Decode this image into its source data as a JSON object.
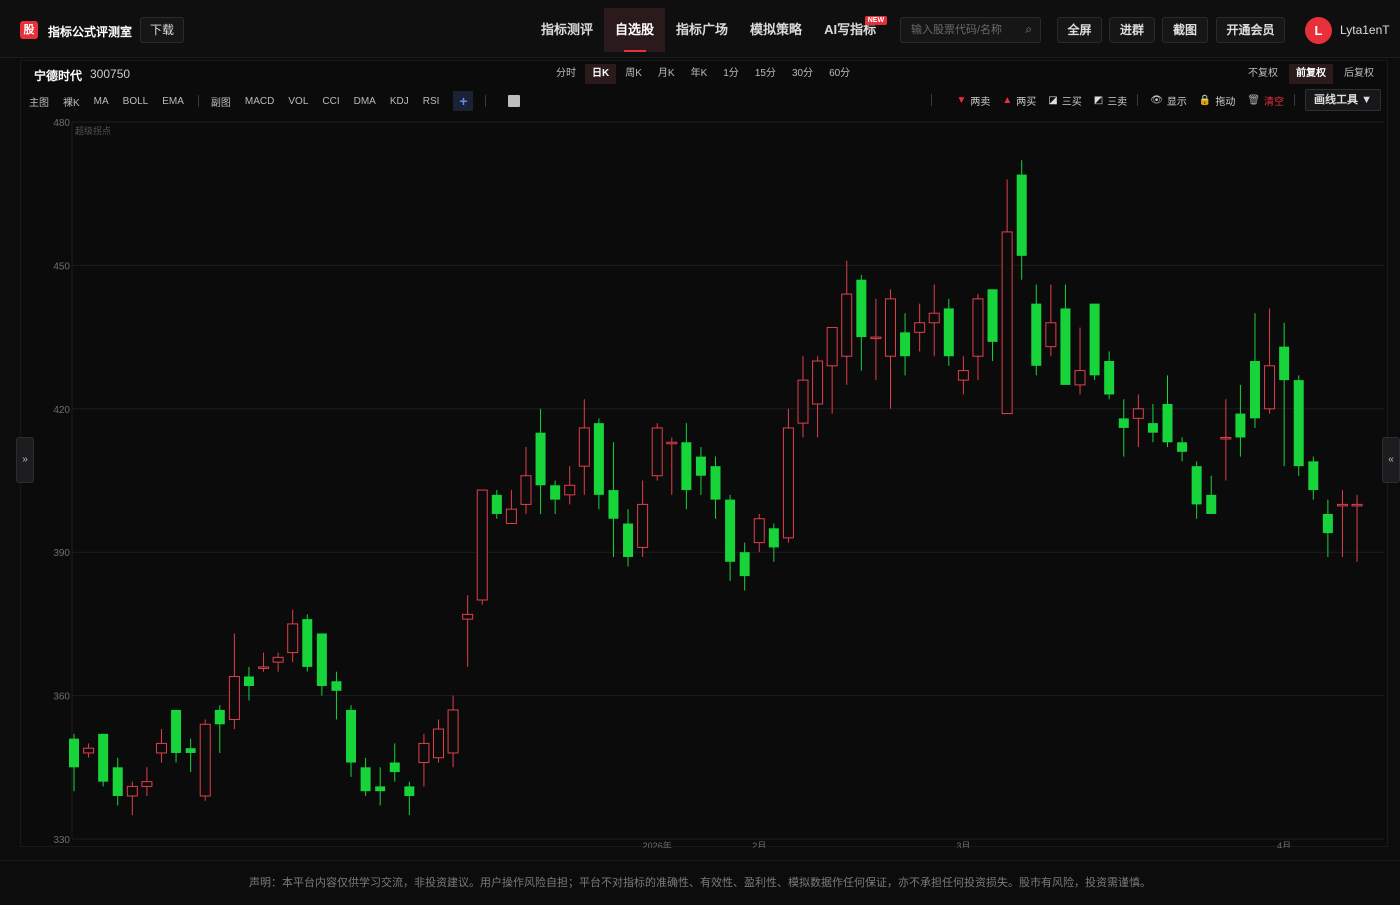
{
  "header": {
    "logo_text": "股",
    "brand": "指标公式评测室",
    "download": "下载",
    "nav": [
      "指标测评",
      "自选股",
      "指标广场",
      "模拟策略",
      "AI写指标"
    ],
    "nav_active": 1,
    "ai_badge": "NEW",
    "search_placeholder": "输入股票代码/名称",
    "buttons": [
      "全屏",
      "进群",
      "截图",
      "开通会员"
    ],
    "avatar_letter": "L",
    "username": "Lyta1enT"
  },
  "stock": {
    "name": "宁德时代",
    "code": "300750"
  },
  "periods": [
    "分时",
    "日K",
    "周K",
    "月K",
    "年K",
    "1分",
    "15分",
    "30分",
    "60分"
  ],
  "period_active": 1,
  "rights": [
    "不复权",
    "前复权",
    "后复权"
  ],
  "rights_active": 1,
  "main_indicators": [
    "主图",
    "裸K",
    "MA",
    "BOLL",
    "EMA"
  ],
  "sub_indicators": [
    "副图",
    "MACD",
    "VOL",
    "CCI",
    "DMA",
    "KDJ",
    "RSI"
  ],
  "add_label": "+",
  "draw_tools": {
    "two_sell": "两卖",
    "two_buy": "两买",
    "three_buy": "三买",
    "three_sell": "三卖",
    "show": "显示",
    "drag": "拖动",
    "clear": "清空",
    "menu": "画线工具 ▼"
  },
  "chart_watermark": "超级拐点",
  "side_left": "»",
  "side_right": "«",
  "chart_data": {
    "type": "candlestick",
    "ylim": [
      330,
      480
    ],
    "yticks": [
      330,
      360,
      390,
      420,
      450,
      480
    ],
    "x_tick_labels": [
      "2026年",
      "2月",
      "3月",
      "4月"
    ],
    "x_tick_index": [
      40,
      47,
      61,
      83
    ],
    "colors": {
      "up": "#e0404a",
      "down": "#16d43a"
    },
    "candles": [
      [
        351,
        345,
        352,
        340
      ],
      [
        348,
        349,
        350,
        347
      ],
      [
        352,
        342,
        352,
        341
      ],
      [
        345,
        339,
        347,
        337
      ],
      [
        339,
        341,
        342,
        335
      ],
      [
        341,
        342,
        345,
        339
      ],
      [
        348,
        350,
        353,
        346
      ],
      [
        357,
        348,
        357,
        346
      ],
      [
        349,
        348,
        351,
        344
      ],
      [
        339,
        354,
        355,
        338
      ],
      [
        357,
        354,
        358,
        348
      ],
      [
        355,
        364,
        373,
        353
      ],
      [
        364,
        362,
        366,
        359
      ],
      [
        366,
        366,
        369,
        365
      ],
      [
        367,
        368,
        369,
        365
      ],
      [
        369,
        375,
        378,
        367
      ],
      [
        376,
        366,
        377,
        365
      ],
      [
        373,
        362,
        373,
        360
      ],
      [
        363,
        361,
        365,
        355
      ],
      [
        357,
        346,
        358,
        343
      ],
      [
        345,
        340,
        347,
        339
      ],
      [
        341,
        340,
        345,
        337
      ],
      [
        346,
        344,
        350,
        342
      ],
      [
        341,
        339,
        342,
        335
      ],
      [
        346,
        350,
        352,
        341
      ],
      [
        347,
        353,
        355,
        346
      ],
      [
        348,
        357,
        360,
        345
      ],
      [
        376,
        377,
        381,
        366
      ],
      [
        380,
        403,
        403,
        379
      ],
      [
        402,
        398,
        403,
        397
      ],
      [
        396,
        399,
        403,
        396
      ],
      [
        400,
        406,
        412,
        398
      ],
      [
        415,
        404,
        420,
        398
      ],
      [
        404,
        401,
        405,
        398
      ],
      [
        402,
        404,
        408,
        400
      ],
      [
        408,
        416,
        422,
        402
      ],
      [
        417,
        402,
        418,
        399
      ],
      [
        403,
        397,
        413,
        389
      ],
      [
        396,
        389,
        399,
        387
      ],
      [
        391,
        400,
        405,
        389
      ],
      [
        406,
        416,
        417,
        405
      ],
      [
        413,
        413,
        414,
        402
      ],
      [
        413,
        403,
        417,
        399
      ],
      [
        410,
        406,
        412,
        402
      ],
      [
        408,
        401,
        410,
        397
      ],
      [
        401,
        388,
        402,
        384
      ],
      [
        390,
        385,
        392,
        382
      ],
      [
        392,
        397,
        398,
        390
      ],
      [
        395,
        391,
        396,
        388
      ],
      [
        393,
        416,
        420,
        392
      ],
      [
        417,
        426,
        431,
        414
      ],
      [
        421,
        430,
        431,
        414
      ],
      [
        429,
        437,
        437,
        419
      ],
      [
        431,
        444,
        451,
        425
      ],
      [
        447,
        435,
        448,
        428
      ],
      [
        435,
        435,
        443,
        426
      ],
      [
        431,
        443,
        445,
        420
      ],
      [
        436,
        431,
        440,
        427
      ],
      [
        436,
        438,
        442,
        432
      ],
      [
        438,
        440,
        446,
        431
      ],
      [
        441,
        431,
        443,
        429
      ],
      [
        426,
        428,
        431,
        423
      ],
      [
        431,
        443,
        444,
        426
      ],
      [
        445,
        434,
        445,
        430
      ],
      [
        419,
        457,
        468,
        435
      ],
      [
        469,
        452,
        472,
        447
      ],
      [
        442,
        429,
        446,
        427
      ],
      [
        433,
        438,
        446,
        431
      ],
      [
        441,
        425,
        446,
        425
      ],
      [
        425,
        428,
        437,
        423
      ],
      [
        442,
        427,
        442,
        426
      ],
      [
        430,
        423,
        432,
        422
      ],
      [
        418,
        416,
        422,
        410
      ],
      [
        418,
        420,
        423,
        412
      ],
      [
        417,
        415,
        421,
        413
      ],
      [
        421,
        413,
        427,
        412
      ],
      [
        413,
        411,
        414,
        409
      ],
      [
        408,
        400,
        409,
        397
      ],
      [
        402,
        398,
        406,
        398
      ],
      [
        414,
        414,
        422,
        405
      ],
      [
        419,
        414,
        425,
        410
      ],
      [
        430,
        418,
        440,
        416
      ],
      [
        420,
        429,
        441,
        419
      ],
      [
        433,
        426,
        438,
        408
      ],
      [
        426,
        408,
        427,
        406
      ],
      [
        409,
        403,
        410,
        401
      ],
      [
        398,
        394,
        401,
        389
      ],
      [
        400,
        400,
        403,
        389
      ],
      [
        400,
        400,
        402,
        388
      ]
    ]
  }
}
